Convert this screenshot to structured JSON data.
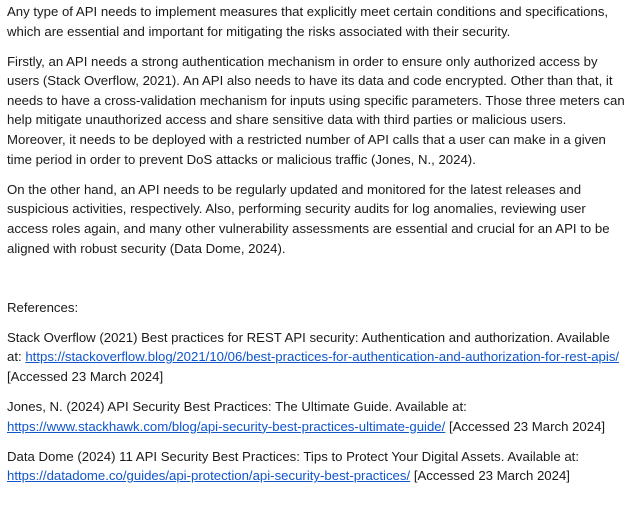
{
  "paragraphs": [
    "Any type of API needs to implement measures that explicitly meet certain conditions and specifications, which are essential and important for mitigating the risks associated with their security.",
    "Firstly, an API needs a strong authentication mechanism in order to ensure only authorized access by users (Stack Overflow, 2021). An API also needs to have its data and code encrypted. Other than that, it needs to have a cross-validation mechanism for inputs using specific parameters. Those three meters can help mitigate unauthorized access and share sensitive data with third parties or malicious users. Moreover, it needs to be deployed with a restricted number of API calls that a user can make in a given time period in order to prevent DoS attacks or malicious traffic (Jones, N., 2024).",
    "On the other hand, an API needs to be regularly updated and monitored for the latest releases and suspicious activities, respectively. Also, performing security audits for log anomalies, reviewing user access roles again, and many other vulnerability assessments are essential and crucial for an API to be aligned with robust security (Data Dome, 2024)."
  ],
  "references": {
    "heading": "References:",
    "items": [
      {
        "text": "Stack Overflow (2021) Best practices for REST API security: Authentication and authorization. Available at: ",
        "url": "https://stackoverflow.blog/2021/10/06/best-practices-for-authentication-and-authorization-for-rest-apis/",
        "accessed": " [Accessed 23 March 2024]"
      },
      {
        "text": "Jones, N. (2024) API Security Best Practices: The Ultimate Guide. Available at: ",
        "url": "https://www.stackhawk.com/blog/api-security-best-practices-ultimate-guide/",
        "accessed": " [Accessed 23 March 2024]"
      },
      {
        "text": "Data Dome (2024) 11 API Security Best Practices: Tips to Protect Your Digital Assets. Available at: ",
        "url": "https://datadome.co/guides/api-protection/api-security-best-practices/",
        "accessed": " [Accessed 23 March 2024]"
      }
    ]
  }
}
